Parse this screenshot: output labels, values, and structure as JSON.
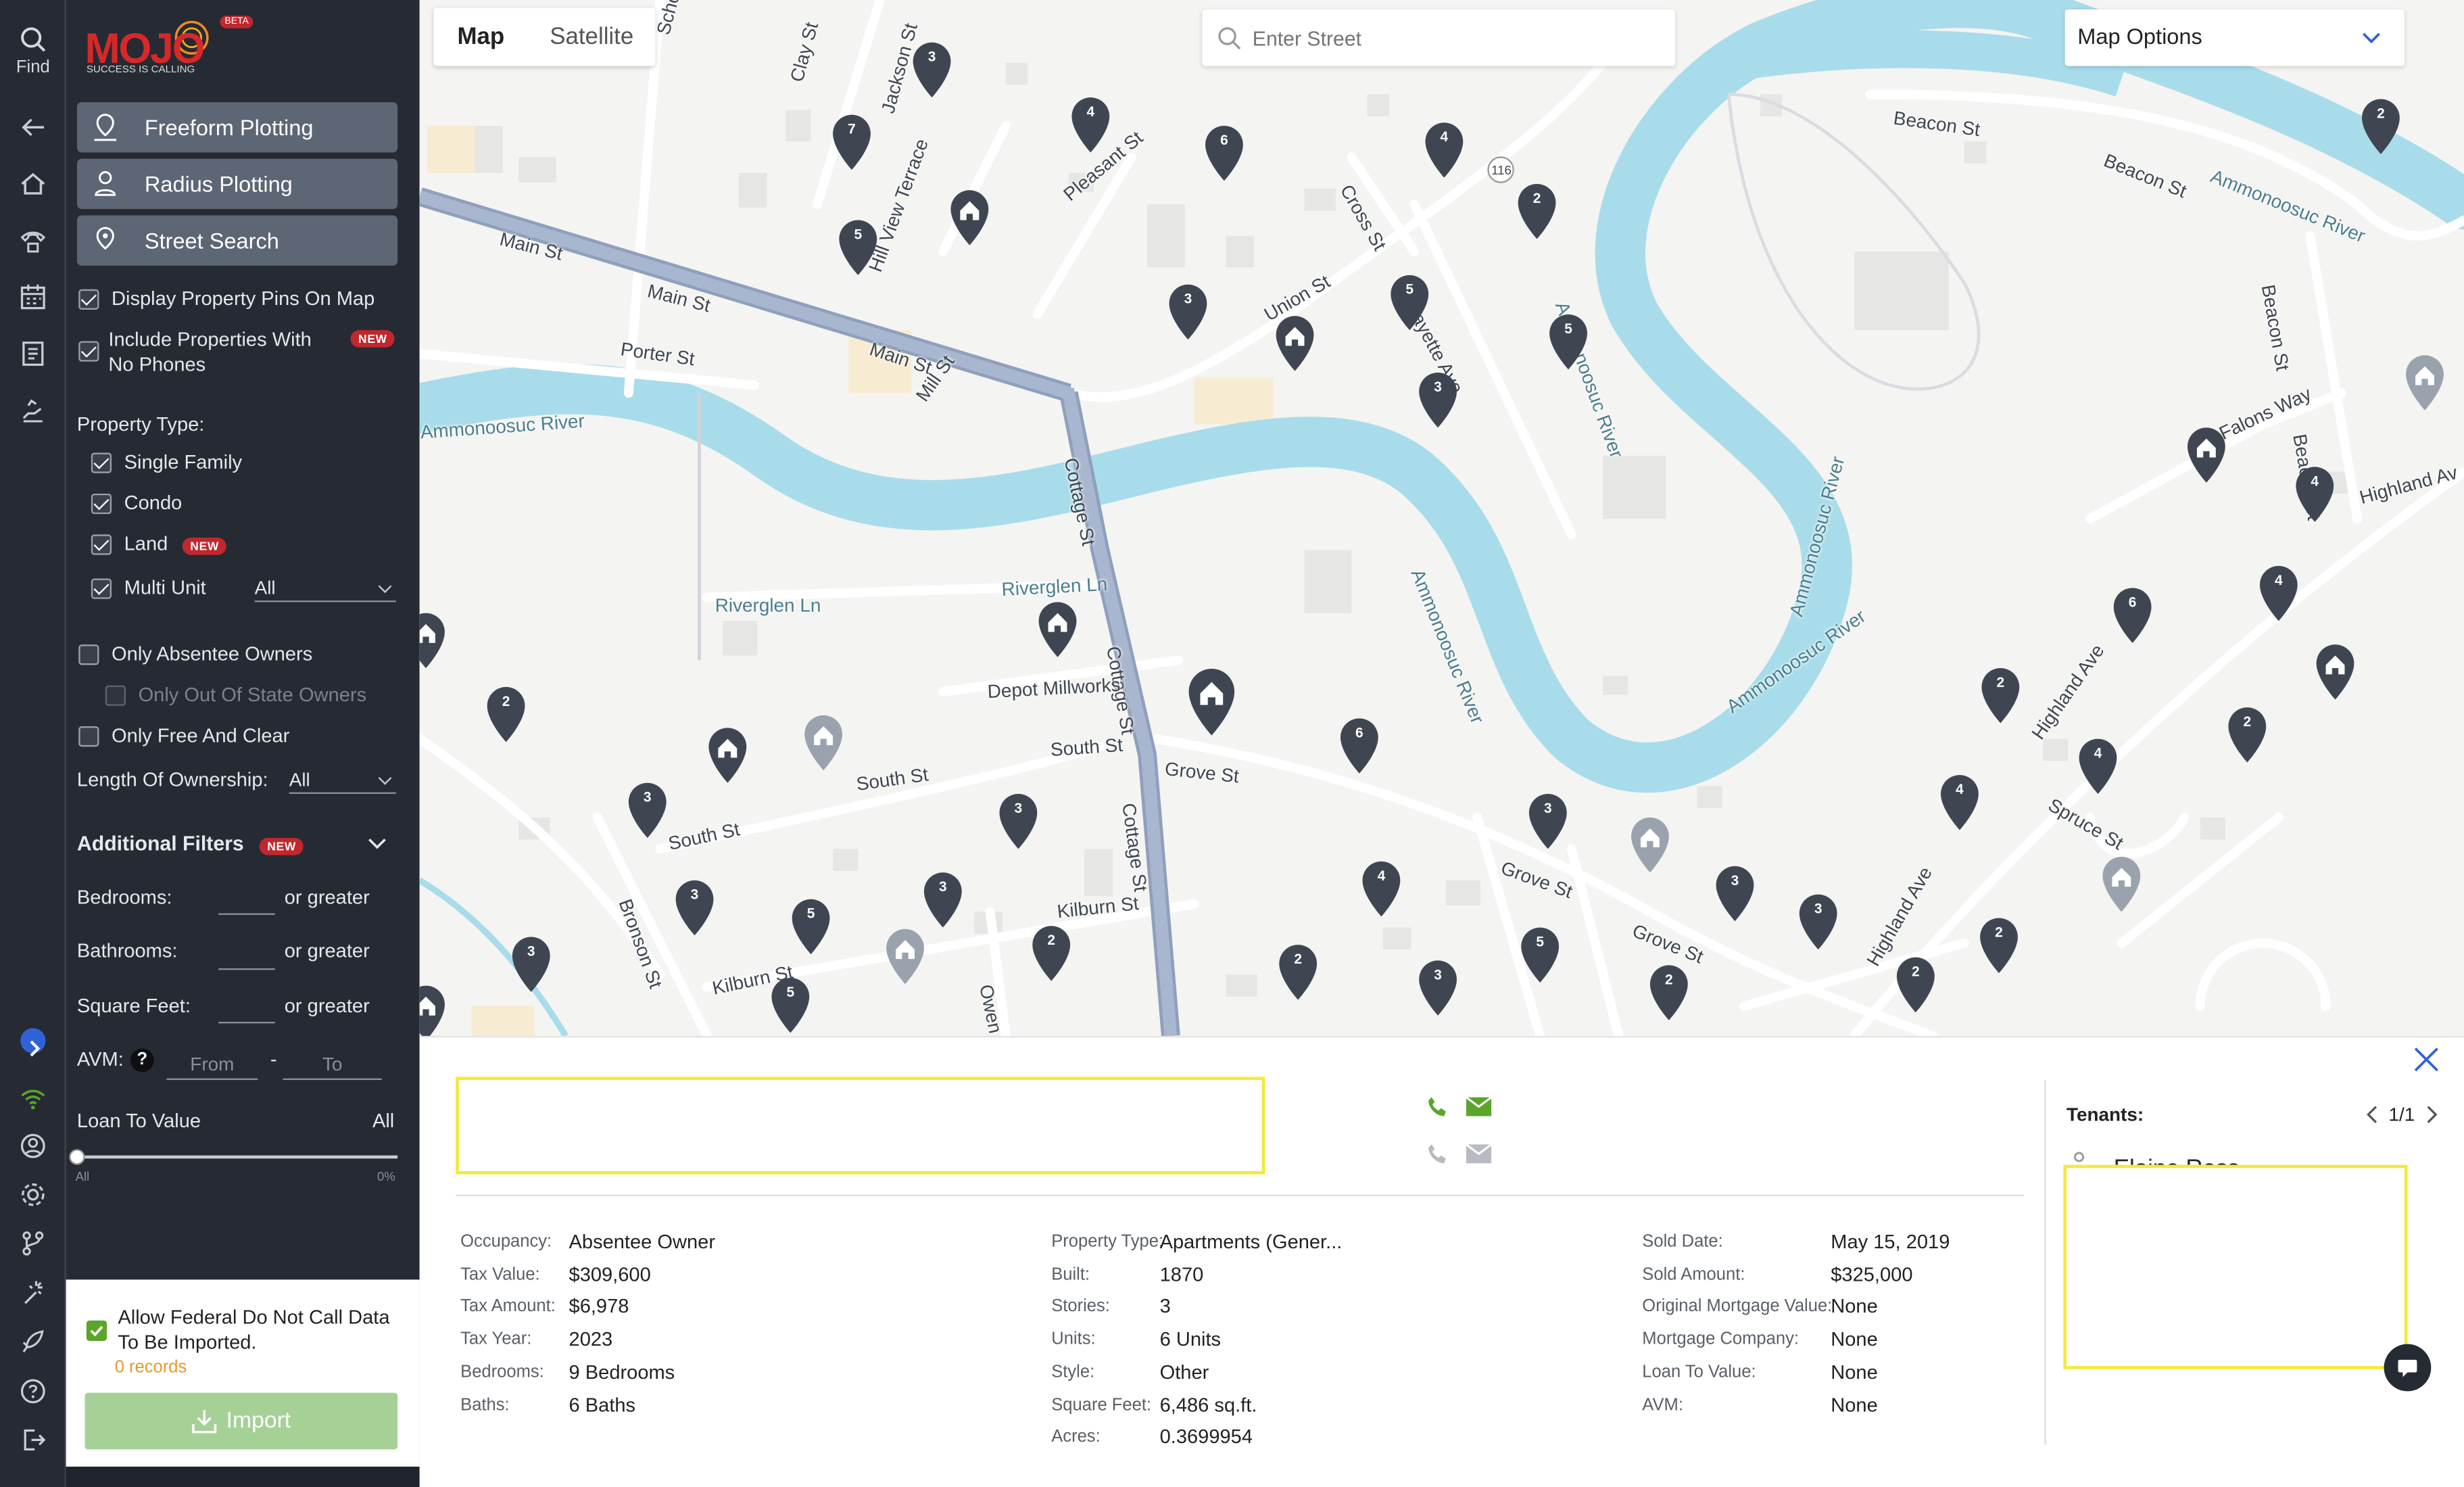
{
  "app": {
    "logo_text": "MOJO",
    "logo_sub": "SUCCESS IS CALLING",
    "logo_badge": "BETA"
  },
  "rail": {
    "find_label": "Find"
  },
  "panel": {
    "freeform": "Freeform Plotting",
    "radius": "Radius Plotting",
    "street": "Street Search",
    "display_pins": "Display Property Pins On Map",
    "include_no_phones": "Include Properties With No Phones",
    "new_badge": "NEW",
    "property_type_label": "Property Type:",
    "types": {
      "single_family": "Single Family",
      "condo": "Condo",
      "land": "Land",
      "multi_unit": "Multi Unit"
    },
    "multi_unit_value": "All",
    "absentee": "Only Absentee Owners",
    "out_of_state": "Only Out Of State Owners",
    "free_clear": "Only Free And Clear",
    "ownership_label": "Length Of Ownership:",
    "ownership_value": "All",
    "additional_filters": "Additional Filters",
    "bedrooms_label": "Bedrooms:",
    "bathrooms_label": "Bathrooms:",
    "sqft_label": "Square Feet:",
    "or_greater": "or greater",
    "avm_label": "AVM:",
    "avm_help": "?",
    "avm_from": "From",
    "avm_to": "To",
    "avm_dash": "-",
    "ltv_label": "Loan To Value",
    "ltv_value": "All",
    "ltv_min": "All",
    "ltv_max": "0%",
    "ltv_level": 0,
    "federal_dnc": "Allow Federal Do Not Call Data To Be Imported.",
    "records": "0 records",
    "import": "Import"
  },
  "map": {
    "tabs": {
      "map": "Map",
      "satellite": "Satellite"
    },
    "search_placeholder": "Enter Street",
    "options_label": "Map Options",
    "streets": {
      "main1": "Main St",
      "main2": "Main St",
      "main3": "Main St",
      "porter": "Porter St",
      "mill": "Mill St",
      "cottage1": "Cottage St",
      "cottage2": "Cottage St",
      "cottage3": "Cottage St",
      "riverglen1": "Riverglen Ln",
      "riverglen2": "Riverglen Ln",
      "depot": "Depot Millworks",
      "south1": "South St",
      "south2": "South St",
      "south3": "South St",
      "grove1": "Grove St",
      "grove2": "Grove St",
      "grove3": "Grove St",
      "kilburn1": "Kilburn St",
      "kilburn2": "Kilburn St",
      "bronson": "Bronson St",
      "owen": "Owen Dr",
      "union": "Union St",
      "lafayette": "Lafayette Ave",
      "pleasant": "Pleasant St",
      "hillview": "Hill View Terrace",
      "jackson": "Jackson St",
      "clay": "Clay St",
      "school": "School St",
      "cross": "Cross St",
      "beacon1": "Beacon St",
      "beacon2": "Beacon St",
      "beacon3": "Beacon St",
      "beacon4": "Beacon St",
      "falons": "Falons Way",
      "highland1": "Highland Av",
      "highland2": "Highland Ave",
      "highland3": "Highland Ave",
      "spruce": "Spruce St",
      "river1": "Ammonoosuc River",
      "river2": "Ammonoosuc River",
      "river3": "Ammonoosuc River",
      "river4": "Ammonoosuc River",
      "river5": "Ammonoosuc River",
      "river6": "Ammonoosuc River",
      "route": "116"
    },
    "pins": [
      {
        "t": "3"
      },
      {
        "t": "7"
      },
      {
        "t": "4"
      },
      {
        "t": "6"
      },
      {
        "t": "5"
      },
      {
        "t": "3"
      },
      {
        "t": "4"
      },
      {
        "t": "2"
      },
      {
        "t": "5"
      },
      {
        "t": "3"
      },
      {
        "t": "5"
      },
      {
        "t": "2"
      },
      {
        "t": "2"
      },
      {
        "t": "3"
      },
      {
        "t": "3"
      },
      {
        "t": "3"
      },
      {
        "t": "5"
      },
      {
        "t": "5"
      },
      {
        "t": "3"
      },
      {
        "t": "6"
      },
      {
        "t": "3"
      },
      {
        "t": "4"
      },
      {
        "t": "3"
      },
      {
        "t": "5"
      },
      {
        "t": "2"
      },
      {
        "t": "2"
      },
      {
        "t": "3"
      },
      {
        "t": "2"
      },
      {
        "t": "4"
      },
      {
        "t": "4"
      },
      {
        "t": "6"
      },
      {
        "t": "4"
      },
      {
        "t": "2"
      },
      {
        "t": "2"
      },
      {
        "t": "2"
      },
      {
        "t": "2"
      },
      {
        "t": "3"
      },
      {
        "t": "4"
      },
      {
        "t": "2"
      },
      {
        "t": "3"
      }
    ]
  },
  "detail": {
    "left": [
      {
        "k": "Occupancy:",
        "v": "Absentee Owner"
      },
      {
        "k": "Tax Value:",
        "v": "$309,600"
      },
      {
        "k": "Tax Amount:",
        "v": "$6,978"
      },
      {
        "k": "Tax Year:",
        "v": "2023"
      },
      {
        "k": "Bedrooms:",
        "v": "9 Bedrooms"
      },
      {
        "k": "Baths:",
        "v": "6 Baths"
      }
    ],
    "mid": [
      {
        "k": "Property Type:",
        "v": "Apartments (Gener..."
      },
      {
        "k": "Built:",
        "v": "1870"
      },
      {
        "k": "Stories:",
        "v": "3"
      },
      {
        "k": "Units:",
        "v": "6 Units"
      },
      {
        "k": "Style:",
        "v": "Other"
      },
      {
        "k": "Square Feet:",
        "v": "6,486 sq.ft."
      },
      {
        "k": "Acres:",
        "v": "0.3699954"
      }
    ],
    "right": [
      {
        "k": "Sold Date:",
        "v": "May 15, 2019"
      },
      {
        "k": "Sold Amount:",
        "v": "$325,000"
      },
      {
        "k": "Original Mortgage Value:",
        "v": "None"
      },
      {
        "k": "Mortgage Company:",
        "v": "None"
      },
      {
        "k": "Loan To Value:",
        "v": "None"
      },
      {
        "k": "AVM:",
        "v": "None"
      }
    ],
    "tenants_label": "Tenants:",
    "tenants_page": "1/1",
    "tenant_name": "Elaine Ross"
  },
  "colors": {
    "accent": "#5aa52a",
    "panel": "#262a33",
    "water": "#a8dcea",
    "pin": "#3f4651"
  }
}
